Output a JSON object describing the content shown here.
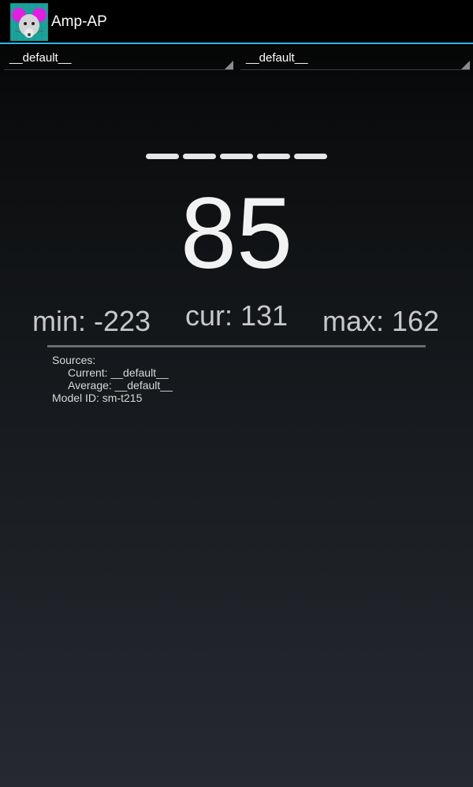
{
  "action_bar": {
    "title": "Amp-AP",
    "icon": "mouse-logo-icon"
  },
  "spinners": {
    "current_source": "__default__",
    "average_source": "__default__"
  },
  "signal_bars": {
    "count": 5,
    "filled": 5,
    "color": "#e6e6e6"
  },
  "reading": {
    "value": "85",
    "min": "min: -223",
    "cur": "cur: 131",
    "max": "max: 162"
  },
  "info": {
    "sources_label": "Sources:",
    "current_line": "Current: __default__",
    "average_line": "Average: __default__",
    "model_line": "Model ID: sm-t215"
  },
  "colors": {
    "accent": "#33b5e5",
    "background_top": "#000000",
    "background_bottom": "#262930"
  }
}
